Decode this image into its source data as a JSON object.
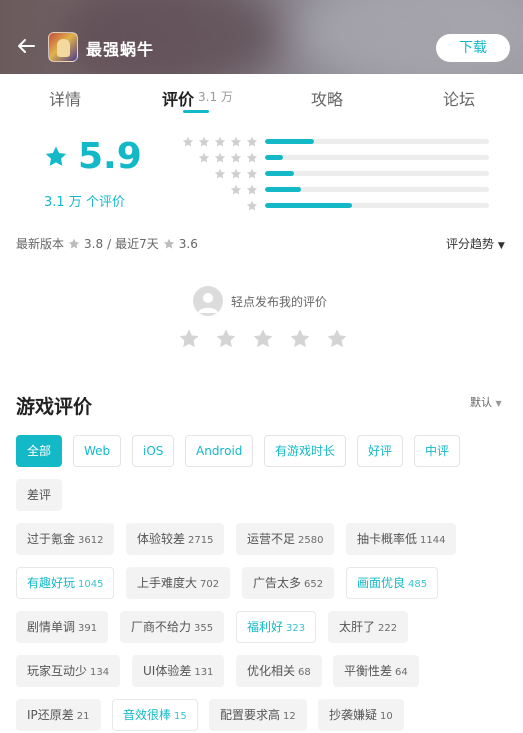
{
  "header": {
    "app_title": "最强蜗牛",
    "download_label": "下载",
    "icons": {
      "back": "back-arrow-icon",
      "app": "app-icon"
    }
  },
  "tabs": {
    "items": [
      {
        "label": "详情"
      },
      {
        "label": "评价",
        "count": "3.1 万",
        "active": true
      },
      {
        "label": "攻略"
      },
      {
        "label": "论坛"
      }
    ]
  },
  "rating": {
    "score": "5.9",
    "count_text": "3.1 万 个评价",
    "distribution": [
      {
        "stars": 5,
        "fraction": 0.22
      },
      {
        "stars": 4,
        "fraction": 0.08
      },
      {
        "stars": 3,
        "fraction": 0.13
      },
      {
        "stars": 2,
        "fraction": 0.16
      },
      {
        "stars": 1,
        "fraction": 0.39
      }
    ],
    "accent_color": "#14b9c8"
  },
  "version_line": {
    "latest_label": "最新版本",
    "latest_score": "3.8",
    "separator": "/",
    "recent_label": "最近7天",
    "recent_score": "3.6"
  },
  "trend_label": "评分趋势",
  "post": {
    "hint": "轻点发布我的评价",
    "star_count": 5
  },
  "reviews": {
    "title": "游戏评价",
    "sort_label": "默认",
    "filters": [
      {
        "label": "全部",
        "style": "active"
      },
      {
        "label": "Web",
        "style": "outline"
      },
      {
        "label": "iOS",
        "style": "outline"
      },
      {
        "label": "Android",
        "style": "outline"
      },
      {
        "label": "有游戏时长",
        "style": "outline"
      },
      {
        "label": "好评",
        "style": "outline"
      },
      {
        "label": "中评",
        "style": "outline"
      },
      {
        "label": "差评",
        "style": "plain"
      }
    ],
    "tags": [
      {
        "label": "过于氪金",
        "count": "3612",
        "style": "plain"
      },
      {
        "label": "体验较差",
        "count": "2715",
        "style": "plain"
      },
      {
        "label": "运营不足",
        "count": "2580",
        "style": "plain"
      },
      {
        "label": "抽卡概率低",
        "count": "1144",
        "style": "plain"
      },
      {
        "label": "有趣好玩",
        "count": "1045",
        "style": "teal"
      },
      {
        "label": "上手难度大",
        "count": "702",
        "style": "plain"
      },
      {
        "label": "广告太多",
        "count": "652",
        "style": "plain"
      },
      {
        "label": "画面优良",
        "count": "485",
        "style": "teal"
      },
      {
        "label": "剧情单调",
        "count": "391",
        "style": "plain"
      },
      {
        "label": "厂商不给力",
        "count": "355",
        "style": "plain"
      },
      {
        "label": "福利好",
        "count": "323",
        "style": "teal"
      },
      {
        "label": "太肝了",
        "count": "222",
        "style": "plain"
      },
      {
        "label": "玩家互动少",
        "count": "134",
        "style": "plain"
      },
      {
        "label": "UI体验差",
        "count": "131",
        "style": "plain"
      },
      {
        "label": "优化相关",
        "count": "68",
        "style": "plain"
      },
      {
        "label": "平衡性差",
        "count": "64",
        "style": "plain"
      },
      {
        "label": "IP还原差",
        "count": "21",
        "style": "plain"
      },
      {
        "label": "音效很棒",
        "count": "15",
        "style": "teal"
      },
      {
        "label": "配置要求高",
        "count": "12",
        "style": "plain"
      },
      {
        "label": "抄袭嫌疑",
        "count": "10",
        "style": "plain"
      }
    ]
  }
}
